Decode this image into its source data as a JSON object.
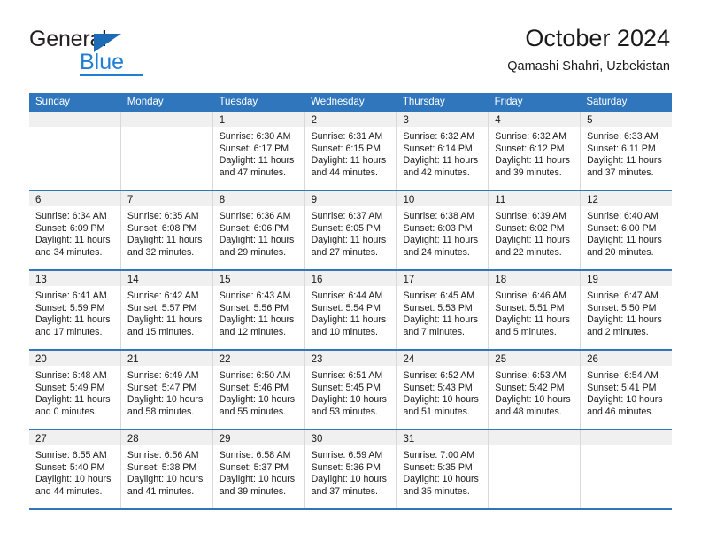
{
  "brand": {
    "name_top": "General",
    "name_bottom": "Blue",
    "accent_color": "#1e7fd4",
    "triangle_color": "#1b6cb5",
    "triangle_icon": "triangle-icon"
  },
  "header": {
    "title": "October 2024",
    "subtitle": "Qamashi Shahri, Uzbekistan"
  },
  "calendar": {
    "header_bg": "#2f76bc",
    "date_strip_bg": "#f0f0f0",
    "weekdays": [
      "Sunday",
      "Monday",
      "Tuesday",
      "Wednesday",
      "Thursday",
      "Friday",
      "Saturday"
    ],
    "weeks": [
      [
        {
          "date": "",
          "empty": true,
          "sunrise": "",
          "sunset": "",
          "daylight_1": "",
          "daylight_2": ""
        },
        {
          "date": "",
          "empty": true,
          "sunrise": "",
          "sunset": "",
          "daylight_1": "",
          "daylight_2": ""
        },
        {
          "date": "1",
          "sunrise": "Sunrise: 6:30 AM",
          "sunset": "Sunset: 6:17 PM",
          "daylight_1": "Daylight: 11 hours",
          "daylight_2": "and 47 minutes."
        },
        {
          "date": "2",
          "sunrise": "Sunrise: 6:31 AM",
          "sunset": "Sunset: 6:15 PM",
          "daylight_1": "Daylight: 11 hours",
          "daylight_2": "and 44 minutes."
        },
        {
          "date": "3",
          "sunrise": "Sunrise: 6:32 AM",
          "sunset": "Sunset: 6:14 PM",
          "daylight_1": "Daylight: 11 hours",
          "daylight_2": "and 42 minutes."
        },
        {
          "date": "4",
          "sunrise": "Sunrise: 6:32 AM",
          "sunset": "Sunset: 6:12 PM",
          "daylight_1": "Daylight: 11 hours",
          "daylight_2": "and 39 minutes."
        },
        {
          "date": "5",
          "sunrise": "Sunrise: 6:33 AM",
          "sunset": "Sunset: 6:11 PM",
          "daylight_1": "Daylight: 11 hours",
          "daylight_2": "and 37 minutes."
        }
      ],
      [
        {
          "date": "6",
          "sunrise": "Sunrise: 6:34 AM",
          "sunset": "Sunset: 6:09 PM",
          "daylight_1": "Daylight: 11 hours",
          "daylight_2": "and 34 minutes."
        },
        {
          "date": "7",
          "sunrise": "Sunrise: 6:35 AM",
          "sunset": "Sunset: 6:08 PM",
          "daylight_1": "Daylight: 11 hours",
          "daylight_2": "and 32 minutes."
        },
        {
          "date": "8",
          "sunrise": "Sunrise: 6:36 AM",
          "sunset": "Sunset: 6:06 PM",
          "daylight_1": "Daylight: 11 hours",
          "daylight_2": "and 29 minutes."
        },
        {
          "date": "9",
          "sunrise": "Sunrise: 6:37 AM",
          "sunset": "Sunset: 6:05 PM",
          "daylight_1": "Daylight: 11 hours",
          "daylight_2": "and 27 minutes."
        },
        {
          "date": "10",
          "sunrise": "Sunrise: 6:38 AM",
          "sunset": "Sunset: 6:03 PM",
          "daylight_1": "Daylight: 11 hours",
          "daylight_2": "and 24 minutes."
        },
        {
          "date": "11",
          "sunrise": "Sunrise: 6:39 AM",
          "sunset": "Sunset: 6:02 PM",
          "daylight_1": "Daylight: 11 hours",
          "daylight_2": "and 22 minutes."
        },
        {
          "date": "12",
          "sunrise": "Sunrise: 6:40 AM",
          "sunset": "Sunset: 6:00 PM",
          "daylight_1": "Daylight: 11 hours",
          "daylight_2": "and 20 minutes."
        }
      ],
      [
        {
          "date": "13",
          "sunrise": "Sunrise: 6:41 AM",
          "sunset": "Sunset: 5:59 PM",
          "daylight_1": "Daylight: 11 hours",
          "daylight_2": "and 17 minutes."
        },
        {
          "date": "14",
          "sunrise": "Sunrise: 6:42 AM",
          "sunset": "Sunset: 5:57 PM",
          "daylight_1": "Daylight: 11 hours",
          "daylight_2": "and 15 minutes."
        },
        {
          "date": "15",
          "sunrise": "Sunrise: 6:43 AM",
          "sunset": "Sunset: 5:56 PM",
          "daylight_1": "Daylight: 11 hours",
          "daylight_2": "and 12 minutes."
        },
        {
          "date": "16",
          "sunrise": "Sunrise: 6:44 AM",
          "sunset": "Sunset: 5:54 PM",
          "daylight_1": "Daylight: 11 hours",
          "daylight_2": "and 10 minutes."
        },
        {
          "date": "17",
          "sunrise": "Sunrise: 6:45 AM",
          "sunset": "Sunset: 5:53 PM",
          "daylight_1": "Daylight: 11 hours",
          "daylight_2": "and 7 minutes."
        },
        {
          "date": "18",
          "sunrise": "Sunrise: 6:46 AM",
          "sunset": "Sunset: 5:51 PM",
          "daylight_1": "Daylight: 11 hours",
          "daylight_2": "and 5 minutes."
        },
        {
          "date": "19",
          "sunrise": "Sunrise: 6:47 AM",
          "sunset": "Sunset: 5:50 PM",
          "daylight_1": "Daylight: 11 hours",
          "daylight_2": "and 2 minutes."
        }
      ],
      [
        {
          "date": "20",
          "sunrise": "Sunrise: 6:48 AM",
          "sunset": "Sunset: 5:49 PM",
          "daylight_1": "Daylight: 11 hours",
          "daylight_2": "and 0 minutes."
        },
        {
          "date": "21",
          "sunrise": "Sunrise: 6:49 AM",
          "sunset": "Sunset: 5:47 PM",
          "daylight_1": "Daylight: 10 hours",
          "daylight_2": "and 58 minutes."
        },
        {
          "date": "22",
          "sunrise": "Sunrise: 6:50 AM",
          "sunset": "Sunset: 5:46 PM",
          "daylight_1": "Daylight: 10 hours",
          "daylight_2": "and 55 minutes."
        },
        {
          "date": "23",
          "sunrise": "Sunrise: 6:51 AM",
          "sunset": "Sunset: 5:45 PM",
          "daylight_1": "Daylight: 10 hours",
          "daylight_2": "and 53 minutes."
        },
        {
          "date": "24",
          "sunrise": "Sunrise: 6:52 AM",
          "sunset": "Sunset: 5:43 PM",
          "daylight_1": "Daylight: 10 hours",
          "daylight_2": "and 51 minutes."
        },
        {
          "date": "25",
          "sunrise": "Sunrise: 6:53 AM",
          "sunset": "Sunset: 5:42 PM",
          "daylight_1": "Daylight: 10 hours",
          "daylight_2": "and 48 minutes."
        },
        {
          "date": "26",
          "sunrise": "Sunrise: 6:54 AM",
          "sunset": "Sunset: 5:41 PM",
          "daylight_1": "Daylight: 10 hours",
          "daylight_2": "and 46 minutes."
        }
      ],
      [
        {
          "date": "27",
          "sunrise": "Sunrise: 6:55 AM",
          "sunset": "Sunset: 5:40 PM",
          "daylight_1": "Daylight: 10 hours",
          "daylight_2": "and 44 minutes."
        },
        {
          "date": "28",
          "sunrise": "Sunrise: 6:56 AM",
          "sunset": "Sunset: 5:38 PM",
          "daylight_1": "Daylight: 10 hours",
          "daylight_2": "and 41 minutes."
        },
        {
          "date": "29",
          "sunrise": "Sunrise: 6:58 AM",
          "sunset": "Sunset: 5:37 PM",
          "daylight_1": "Daylight: 10 hours",
          "daylight_2": "and 39 minutes."
        },
        {
          "date": "30",
          "sunrise": "Sunrise: 6:59 AM",
          "sunset": "Sunset: 5:36 PM",
          "daylight_1": "Daylight: 10 hours",
          "daylight_2": "and 37 minutes."
        },
        {
          "date": "31",
          "sunrise": "Sunrise: 7:00 AM",
          "sunset": "Sunset: 5:35 PM",
          "daylight_1": "Daylight: 10 hours",
          "daylight_2": "and 35 minutes."
        },
        {
          "date": "",
          "empty": true,
          "sunrise": "",
          "sunset": "",
          "daylight_1": "",
          "daylight_2": ""
        },
        {
          "date": "",
          "empty": true,
          "sunrise": "",
          "sunset": "",
          "daylight_1": "",
          "daylight_2": ""
        }
      ]
    ]
  }
}
